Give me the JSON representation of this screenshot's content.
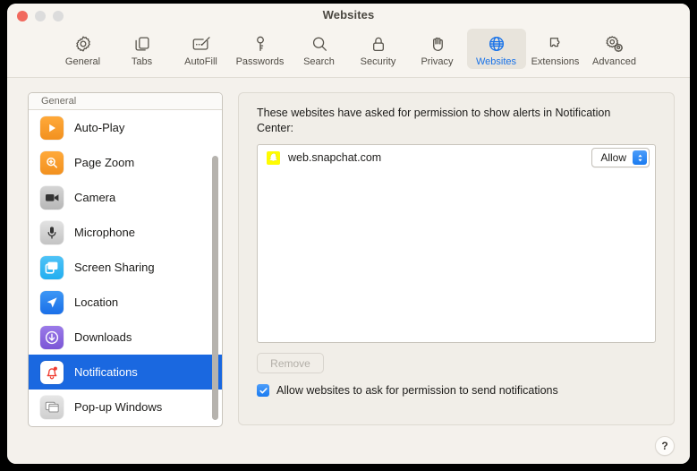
{
  "window": {
    "title": "Websites",
    "traffic_lights": [
      "close",
      "minimize",
      "zoom"
    ]
  },
  "toolbar": {
    "items": [
      {
        "label": "General",
        "icon": "gear-icon",
        "selected": false
      },
      {
        "label": "Tabs",
        "icon": "tabs-icon",
        "selected": false
      },
      {
        "label": "AutoFill",
        "icon": "autofill-icon",
        "selected": false
      },
      {
        "label": "Passwords",
        "icon": "key-icon",
        "selected": false
      },
      {
        "label": "Search",
        "icon": "search-icon",
        "selected": false
      },
      {
        "label": "Security",
        "icon": "lock-icon",
        "selected": false
      },
      {
        "label": "Privacy",
        "icon": "hand-icon",
        "selected": false
      },
      {
        "label": "Websites",
        "icon": "globe-icon",
        "selected": true
      },
      {
        "label": "Extensions",
        "icon": "puzzle-icon",
        "selected": false
      },
      {
        "label": "Advanced",
        "icon": "gears-icon",
        "selected": false
      }
    ],
    "selected_color": "#1a73e8"
  },
  "sidebar": {
    "header": "General",
    "items": [
      {
        "label": "Auto-Play",
        "icon": "play-icon",
        "selected": false
      },
      {
        "label": "Page Zoom",
        "icon": "zoom-in-icon",
        "selected": false
      },
      {
        "label": "Camera",
        "icon": "camera-icon",
        "selected": false
      },
      {
        "label": "Microphone",
        "icon": "microphone-icon",
        "selected": false
      },
      {
        "label": "Screen Sharing",
        "icon": "screen-share-icon",
        "selected": false
      },
      {
        "label": "Location",
        "icon": "location-icon",
        "selected": false
      },
      {
        "label": "Downloads",
        "icon": "download-icon",
        "selected": false
      },
      {
        "label": "Notifications",
        "icon": "bell-icon",
        "selected": true
      },
      {
        "label": "Pop-up Windows",
        "icon": "popup-window-icon",
        "selected": false
      }
    ],
    "selection_color": "#1a68e0"
  },
  "content": {
    "description": "These websites have asked for permission to show alerts in Notification Center:",
    "sites": [
      {
        "name": "web.snapchat.com",
        "favicon": "snapchat-ghost-icon",
        "favicon_color": "#fffc00",
        "permission": "Allow"
      }
    ],
    "remove_button": {
      "label": "Remove",
      "enabled": false
    },
    "allow_checkbox": {
      "label": "Allow websites to ask for permission to send notifications",
      "checked": true
    }
  },
  "help": {
    "label": "?"
  }
}
